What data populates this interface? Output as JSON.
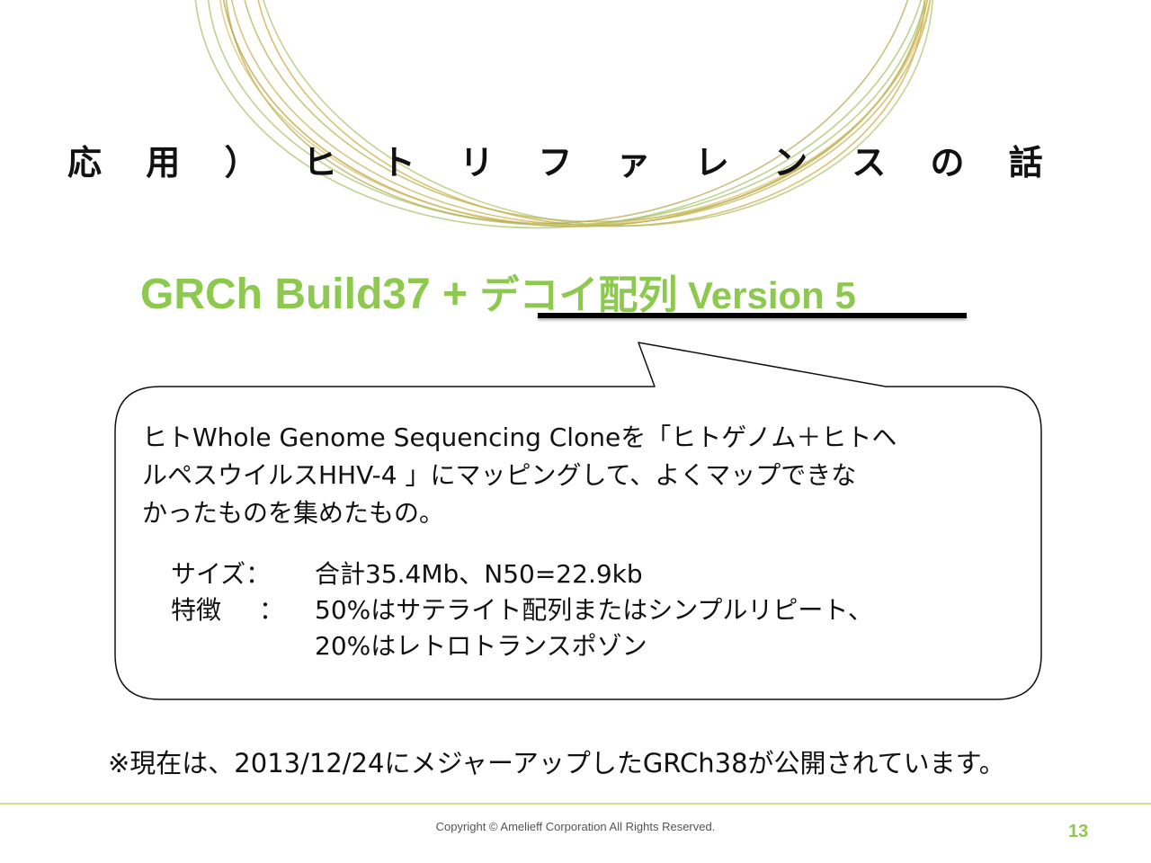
{
  "slide": {
    "title": "応 用 ） ヒ ト リ フ ァ レ ン ス の 話",
    "headline": {
      "part1": "GRCh Build37 + ",
      "part2": "デコイ配列",
      "part3": " Version 5"
    },
    "bubble": {
      "line1": "ヒトWhole Genome Sequencing Cloneを「ヒトゲノム＋ヒトヘ",
      "line2": "ルペスウイルスHHV-4 」にマッピングして、よくマップできな",
      "line3": "かったものを集めたもの。",
      "size_label": "サイズ：",
      "size_value": "合計35.4Mb、N50=22.9kb",
      "feature_label": "特徴",
      "feature_colon": "：",
      "feature_value1": "50%はサテライト配列またはシンプルリピート、",
      "feature_value2": "20%はレトロトランスポゾン"
    },
    "note": "※現在は、2013/12/24にメジャーアップしたGRCh38が公開されています。",
    "copyright": "Copyright © Amelieff Corporation All Rights Reserved.",
    "page_number": "13"
  },
  "colors": {
    "accent_green": "#8dc84f",
    "ring_gold": "#c9a94a",
    "ring_green": "#a8c46a"
  }
}
